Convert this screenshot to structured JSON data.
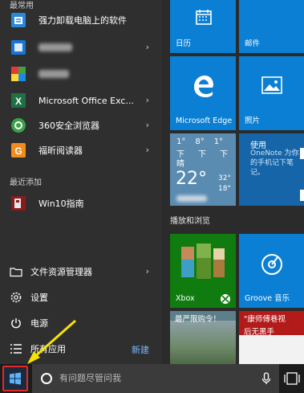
{
  "left": {
    "section_top": "最常用",
    "most_used": [
      {
        "label": "强力卸载电脑上的软件",
        "chevron": false,
        "icon": "uninstall-tool-icon"
      },
      {
        "label": "",
        "chevron": true,
        "icon": "blue-app-icon"
      },
      {
        "label": "",
        "chevron": false,
        "icon": "colorful-app-icon"
      },
      {
        "label": "Microsoft Office Exc...",
        "chevron": true,
        "icon": "excel-icon"
      },
      {
        "label": "360安全浏览器",
        "chevron": true,
        "icon": "360-browser-icon"
      },
      {
        "label": "福昕阅读器",
        "chevron": true,
        "icon": "foxit-reader-icon"
      }
    ],
    "recent_label": "最近添加",
    "recent": [
      {
        "label": "Win10指南",
        "icon": "win10-guide-icon"
      }
    ],
    "bottom": [
      {
        "label": "文件资源管理器",
        "chevron": true,
        "icon": "folder-icon"
      },
      {
        "label": "设置",
        "chevron": false,
        "icon": "gear-icon"
      },
      {
        "label": "电源",
        "chevron": false,
        "icon": "power-icon"
      },
      {
        "label": "所有应用",
        "chevron": false,
        "icon": "list-icon"
      }
    ],
    "new_label": "新建"
  },
  "tiles": {
    "calendar": "日历",
    "mail": "邮件",
    "edge": "Microsoft Edge",
    "photos": "照片",
    "weather": {
      "forecast": [
        {
          "day": "1°",
          "night": "下"
        },
        {
          "day": "8°",
          "night": "下"
        },
        {
          "day": "1°",
          "night": "下"
        }
      ],
      "condition": "晴",
      "temp": "22°",
      "hi": "32°",
      "lo": "18°"
    },
    "onenote": {
      "title": "使用",
      "text": "OneNote 为你的手机记下笔记。"
    },
    "group2": "播放和浏览",
    "xbox": "Xbox",
    "groove": "Groove 音乐",
    "bottom_left": "最严限购令！",
    "bottom_right_top": "\"康师傅巷视",
    "bottom_right_text": "后无黑手"
  },
  "taskbar": {
    "search_placeholder": "有问题尽管问我"
  },
  "colors": {
    "tile_blue": "#0a7fd4",
    "xbox_green": "#107c10",
    "news_red": "#b31b1b",
    "start_highlight": "#e02a2a",
    "arrow_yellow": "#f5e400"
  }
}
